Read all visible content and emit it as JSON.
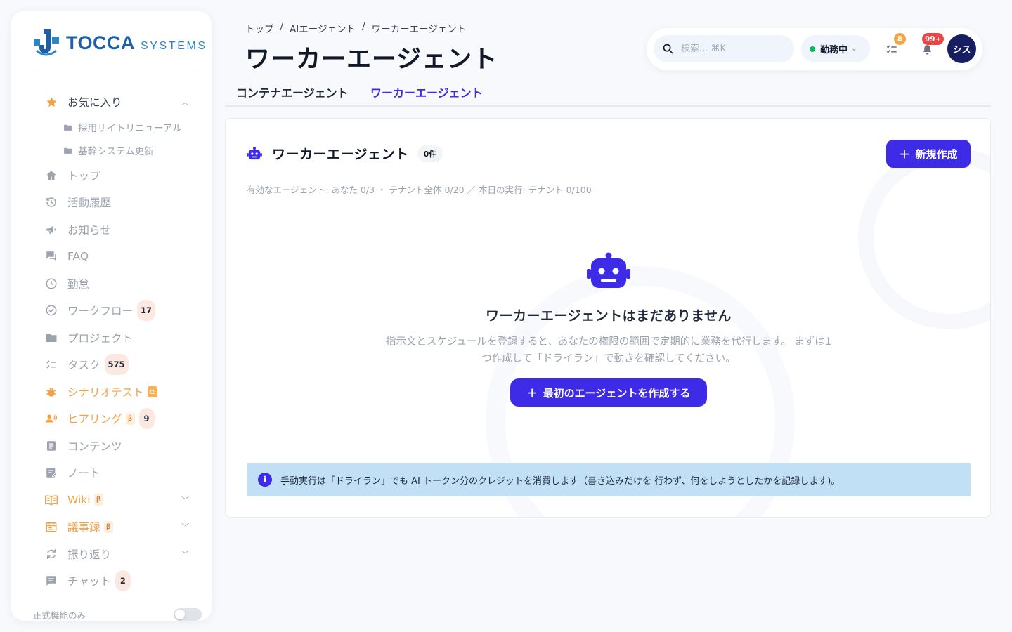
{
  "brand": {
    "name": "TOCCA",
    "sub": "SYSTEMS"
  },
  "sidebar": {
    "favorites": {
      "label": "お気に入り",
      "items": [
        "採用サイトリニューアル",
        "基幹システム更新"
      ]
    },
    "items": [
      {
        "label": "トップ",
        "icon": "home-icon"
      },
      {
        "label": "活動履歴",
        "icon": "history-icon"
      },
      {
        "label": "お知らせ",
        "icon": "megaphone-icon"
      },
      {
        "label": "FAQ",
        "icon": "faq-icon"
      },
      {
        "label": "勤怠",
        "icon": "clock-icon"
      },
      {
        "label": "ワークフロー",
        "icon": "check-circle-icon",
        "count": "17"
      },
      {
        "label": "プロジェクト",
        "icon": "folder-icon"
      },
      {
        "label": "タスク",
        "icon": "checklist-icon",
        "count": "575"
      },
      {
        "label": "シナリオテスト",
        "icon": "bug-icon",
        "tag": "α"
      },
      {
        "label": "ヒアリング",
        "icon": "people-icon",
        "tag": "β",
        "count": "9"
      },
      {
        "label": "コンテンツ",
        "icon": "document-icon"
      },
      {
        "label": "ノート",
        "icon": "note-icon"
      },
      {
        "label": "Wiki",
        "icon": "book-icon",
        "tag": "β"
      },
      {
        "label": "議事録",
        "icon": "calendar-icon",
        "tag": "β"
      },
      {
        "label": "振り返り",
        "icon": "refresh-icon"
      },
      {
        "label": "チャット",
        "icon": "chat-icon",
        "count": "2"
      }
    ],
    "footer_label": "正式機能のみ"
  },
  "header": {
    "breadcrumb": [
      "トップ",
      "AIエージェント",
      "ワーカーエージェント"
    ],
    "breadcrumb_sep": "/",
    "title": "ワーカーエージェント",
    "search_placeholder": "検索... ⌘K",
    "status": "勤務中",
    "task_badge": "8",
    "notif_badge": "99+",
    "avatar": "シス"
  },
  "tabs": [
    "コンテナエージェント",
    "ワーカーエージェント"
  ],
  "active_tab": "ワーカーエージェント",
  "card": {
    "title": "ワーカーエージェント",
    "count": "0件",
    "new_button": "新規作成",
    "meta": "有効なエージェント: あなた 0/3 ・ テナント全体 0/20 ／ 本日の実行: テナント 0/100",
    "empty_title": "ワーカーエージェントはまだありません",
    "empty_desc": "指示文とスケジュールを登録すると、あなたの権限の範囲で定期的に業務を代行します。 まずは1つ作成して「ドライラン」で動きを確認してください。",
    "create_button": "最初のエージェントを作成する",
    "notice": "手動実行は「ドライラン」でも AI トークン分のクレジットを消費します（書き込みだけを 行わず、何をしようとしたかを記録します)。"
  },
  "colors": {
    "primary": "#3d2be8",
    "accent_orange": "#f0a24a",
    "status_green": "#16b364",
    "notif_red": "#ef4444",
    "notice_bg": "#c1dff5"
  }
}
